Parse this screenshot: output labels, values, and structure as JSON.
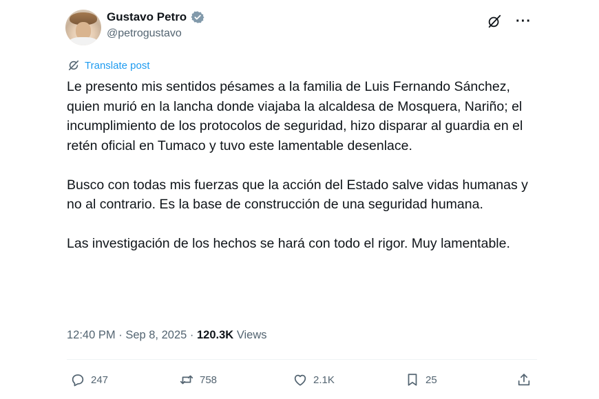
{
  "author": {
    "display_name": "Gustavo Petro",
    "handle": "@petrogustavo"
  },
  "top_icons": [
    "grok-icon",
    "more-icon"
  ],
  "translate_label": "Translate post",
  "paragraphs": [
    "Le presento mis sentidos pésames a la familia de Luis Fernando Sánchez, quien murió en la lancha donde viajaba la alcaldesa de Mosquera, Nariño; el incumplimiento de los protocolos de seguridad, hizo disparar al guardia en el retén oficial en Tumaco y tuvo este lamentable desenlace.",
    "Busco con todas mis fuerzas que la acción del Estado salve vidas humanas y no al contrario. Es la base de construcción de una seguridad humana.",
    "Las investigación de los hechos se hará con todo el rigor. Muy lamentable."
  ],
  "meta": {
    "time": "12:40 PM",
    "date": "Sep 8, 2025",
    "views_count": "120.3K",
    "views_label": "Views"
  },
  "actions": {
    "replies": "247",
    "reposts": "758",
    "likes": "2.1K",
    "bookmarks": "25"
  },
  "colors": {
    "link": "#1d9bf0",
    "muted": "#536471",
    "text": "#0f1419",
    "verified": "#829aab"
  }
}
